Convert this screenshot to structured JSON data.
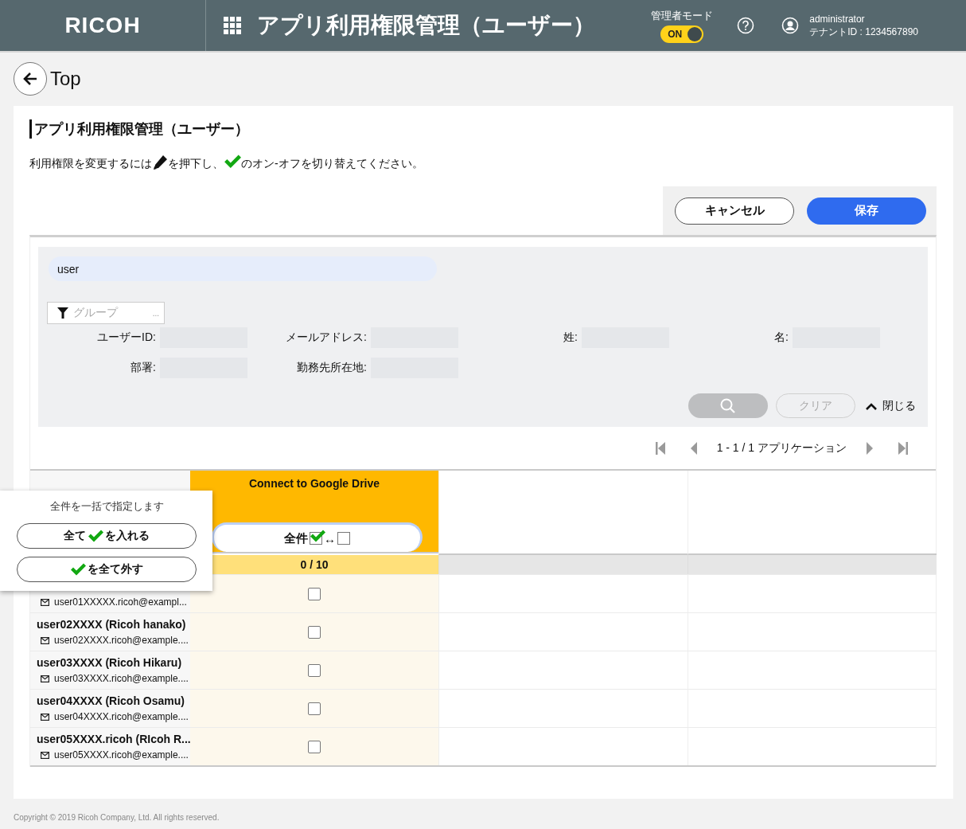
{
  "header": {
    "logo": "RICOH",
    "title": "アプリ利用権限管理（ユーザー）",
    "admin_mode": {
      "label": "管理者モード",
      "on": true,
      "toggle_text": "ON"
    },
    "user": {
      "name": "administrator",
      "tenant": "テナントID : 1234567890"
    }
  },
  "back": {
    "label": "Top"
  },
  "page_title": "アプリ利用権限管理（ユーザー）",
  "instruction": [
    "利用権限を変更するには",
    "を押下し、",
    "のオン-オフを切り替えてください。"
  ],
  "actions": {
    "cancel": "キャンセル",
    "save": "保存"
  },
  "search": {
    "value": "user",
    "group_placeholder": "グループ",
    "group_more": "...",
    "filters": [
      {
        "label": "ユーザーID:"
      },
      {
        "label": "メールアドレス:"
      },
      {
        "label": "姓:"
      },
      {
        "label": "名:"
      },
      {
        "label": "部署:"
      },
      {
        "label": "勤務先所在地:"
      }
    ],
    "clear": "クリア",
    "collapse": "閉じる"
  },
  "pagination": {
    "text": "1 - 1 / 1 アプリケーション"
  },
  "table": {
    "app_column": {
      "title": "Connect to Google Drive",
      "highlighted": true,
      "toggle_label": "全件",
      "toggle_arrow": "↔",
      "count": "0 / 10"
    },
    "rows": [
      {
        "email": "user01XXXXX.ricoh@exampl...",
        "checked": false
      },
      {
        "name": "user02XXXX (Ricoh hanako)",
        "email": "user02XXXX.ricoh@example....",
        "checked": false
      },
      {
        "name": "user03XXXX (Ricoh Hikaru)",
        "email": "user03XXXX.ricoh@example....",
        "checked": false
      },
      {
        "name": "user04XXXX (Ricoh Osamu)",
        "email": "user04XXXX.ricoh@example....",
        "checked": false
      },
      {
        "name": "user05XXXX.ricoh (RIcoh R...",
        "email": "user05XXXX.ricoh@example....",
        "checked": false
      }
    ]
  },
  "bulk_popup": {
    "title": "全件を一括で指定します",
    "check_all": {
      "before": "全て",
      "after": "を入れる"
    },
    "uncheck_all": {
      "after": "を全て外す"
    }
  },
  "footer": {
    "copyright": "Copyright © 2019 Ricoh Company, Ltd. All rights reserved."
  }
}
